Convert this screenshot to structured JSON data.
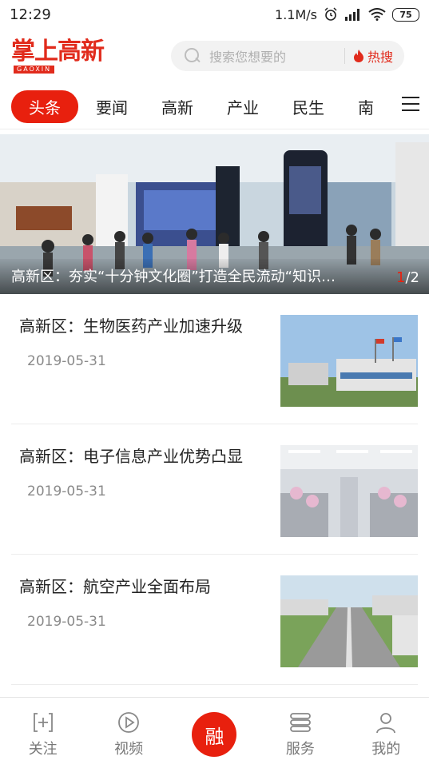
{
  "status_bar": {
    "time": "12:29",
    "network_speed": "1.1M/s",
    "battery": "75",
    "icons": [
      "alarm-icon",
      "signal-icon",
      "wifi-icon",
      "battery-icon"
    ]
  },
  "header": {
    "logo_text": "掌上高新",
    "logo_subtext": "GAOXIN",
    "search_placeholder": "搜索您想要的",
    "hot_search_label": "热搜"
  },
  "tabs": [
    {
      "label": "头条",
      "active": true
    },
    {
      "label": "要闻",
      "active": false
    },
    {
      "label": "高新",
      "active": false
    },
    {
      "label": "产业",
      "active": false
    },
    {
      "label": "民生",
      "active": false
    },
    {
      "label": "南",
      "active": false
    }
  ],
  "banner": {
    "caption": "高新区：夯实“十分钟文化圈”打造全民流动“知识…",
    "pager_current": "1",
    "pager_total": "/2"
  },
  "news": [
    {
      "title": "高新区：生物医药产业加速升级",
      "date": "2019-05-31"
    },
    {
      "title": "高新区：电子信息产业优势凸显",
      "date": "2019-05-31"
    },
    {
      "title": "高新区：航空产业全面布局",
      "date": "2019-05-31"
    }
  ],
  "bottom_nav": [
    {
      "label": "关注",
      "icon": "plus-square-icon"
    },
    {
      "label": "视频",
      "icon": "play-circle-icon"
    },
    {
      "label": "融",
      "icon": "center-action-icon"
    },
    {
      "label": "服务",
      "icon": "list-icon"
    },
    {
      "label": "我的",
      "icon": "user-icon"
    }
  ],
  "colors": {
    "brand_red": "#e8200e",
    "text_dark": "#222222",
    "text_muted": "#8a8a8a"
  }
}
